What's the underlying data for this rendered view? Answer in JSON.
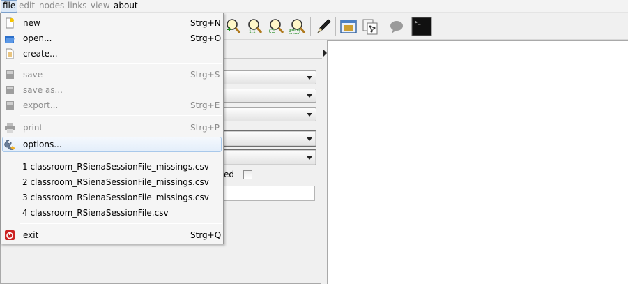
{
  "menubar": {
    "items": [
      {
        "label": "file",
        "state": "open"
      },
      {
        "label": "edit",
        "state": "disabled"
      },
      {
        "label": "nodes",
        "state": "disabled"
      },
      {
        "label": "links",
        "state": "disabled"
      },
      {
        "label": "view",
        "state": "disabled"
      },
      {
        "label": "about",
        "state": "enabled"
      }
    ]
  },
  "file_menu": {
    "new": {
      "label": "new",
      "shortcut": "Strg+N"
    },
    "open": {
      "label": "open...",
      "shortcut": "Strg+O"
    },
    "create": {
      "label": "create...",
      "shortcut": ""
    },
    "save": {
      "label": "save",
      "shortcut": "Strg+S"
    },
    "save_as": {
      "label": "save as...",
      "shortcut": ""
    },
    "export": {
      "label": "export...",
      "shortcut": "Strg+E"
    },
    "print": {
      "label": "print",
      "shortcut": "Strg+P"
    },
    "options": {
      "label": "options..."
    },
    "recent": [
      "1 classroom_RSienaSessionFile_missings.csv",
      "2 classroom_RSienaSessionFile_missings.csv",
      "3 classroom_RSienaSessionFile_missings.csv",
      "4 classroom_RSienaSessionFile.csv"
    ],
    "exit": {
      "label": "exit",
      "shortcut": "Strg+Q"
    }
  },
  "toolbar": {
    "icons": [
      "zoom-in-icon",
      "zoom-1to1-icon",
      "zoom-fit-icon",
      "zoom-selection-icon",
      "pen-icon",
      "list-window-icon",
      "graph-layout-icon",
      "chat-bubble-icon",
      "console-icon"
    ]
  },
  "left_panel": {
    "checkbox_label_fragment": "ed",
    "checkbox_checked": false
  },
  "colors": {
    "menu_highlight": "#dbe8f7",
    "disabled_text": "#8d8d8d",
    "exit_icon": "#cc2222"
  }
}
